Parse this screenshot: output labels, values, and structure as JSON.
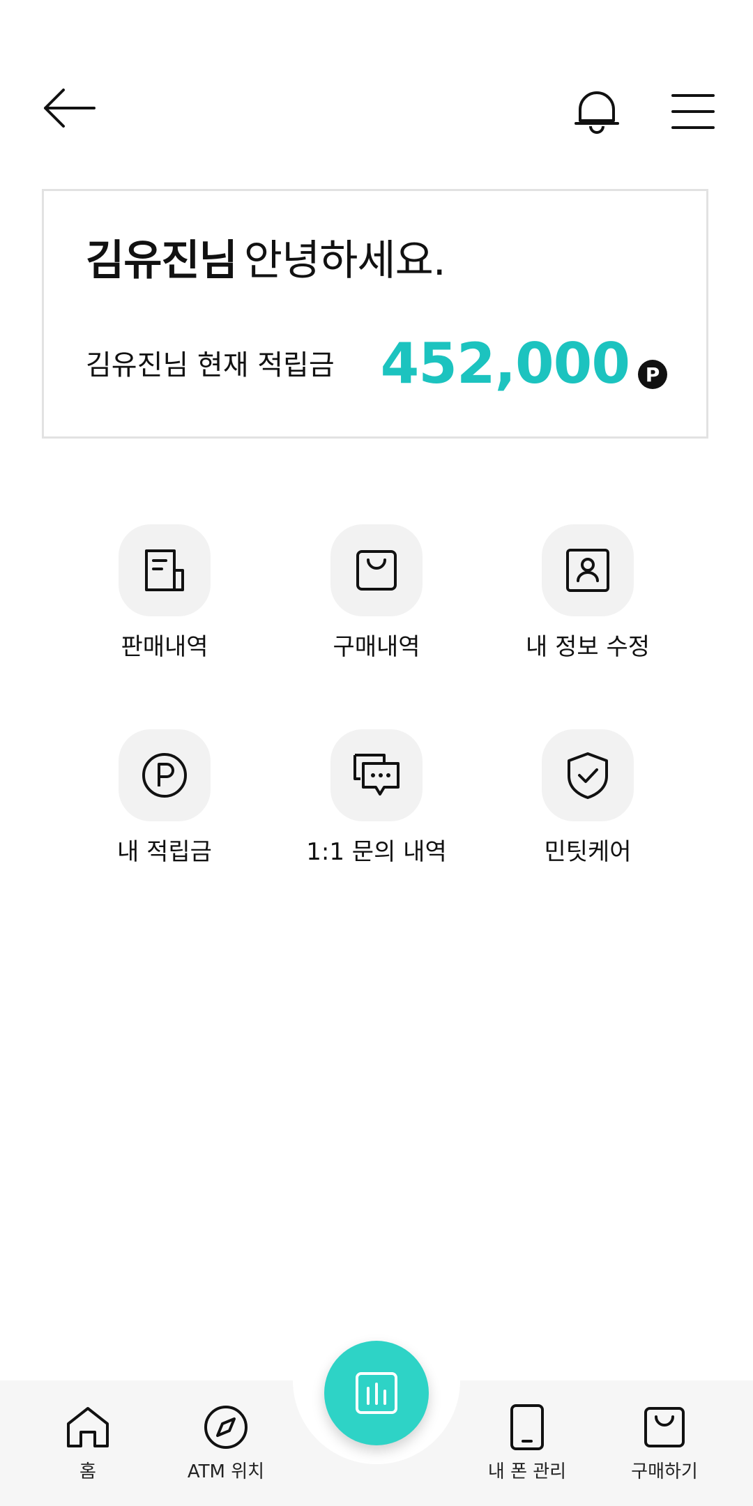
{
  "header": {
    "back_icon": "arrow-left-icon",
    "notification_icon": "bell-icon",
    "menu_icon": "hamburger-menu-icon"
  },
  "greeting_card": {
    "user_name": "김유진님",
    "greeting": "안녕하세요.",
    "balance_label": "김유진님 현재 적립금",
    "balance_value": "452,000",
    "point_badge": "P",
    "accent_color": "#1cc3bf"
  },
  "menu": {
    "items": [
      {
        "label": "판매내역",
        "icon": "receipt-icon"
      },
      {
        "label": "구매내역",
        "icon": "shopping-bag-icon"
      },
      {
        "label": "내 정보 수정",
        "icon": "profile-card-icon"
      },
      {
        "label": "내 적립금",
        "icon": "point-coin-icon"
      },
      {
        "label": "1:1 문의 내역",
        "icon": "chat-bubbles-icon"
      },
      {
        "label": "민팃케어",
        "icon": "shield-check-icon"
      }
    ]
  },
  "bottom_nav": {
    "items": [
      {
        "label": "홈",
        "icon": "home-icon"
      },
      {
        "label": "ATM 위치",
        "icon": "compass-icon"
      },
      {
        "label": "내 폰 관리",
        "icon": "phone-icon"
      },
      {
        "label": "구매하기",
        "icon": "shopping-bag-icon"
      }
    ],
    "center_button_icon": "bar-chart-icon",
    "center_button_color": "#2ed3c6"
  }
}
